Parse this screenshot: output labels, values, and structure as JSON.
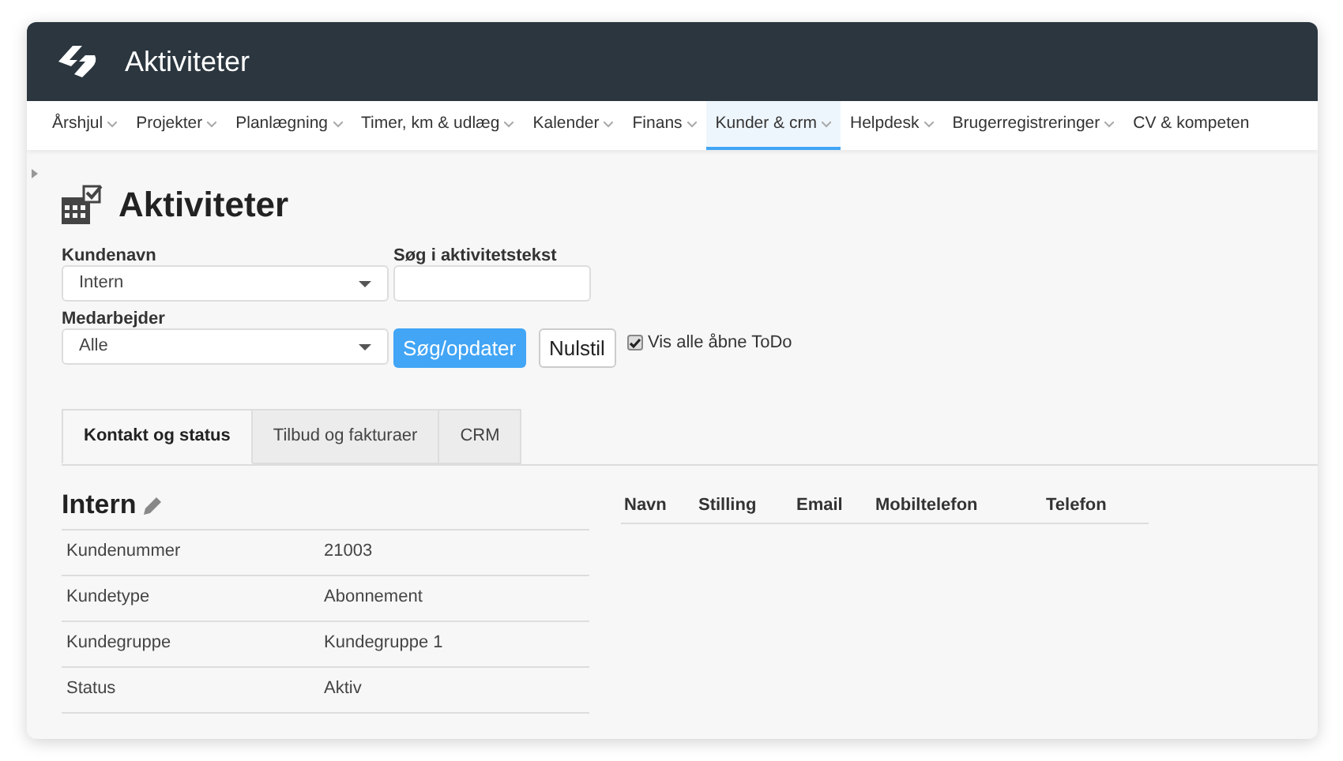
{
  "window": {
    "title": "Aktiviteter"
  },
  "nav": [
    {
      "label": "Årshjul",
      "selected": false
    },
    {
      "label": "Projekter",
      "selected": false
    },
    {
      "label": "Planlægning",
      "selected": false
    },
    {
      "label": "Timer, km & udlæg",
      "selected": false
    },
    {
      "label": "Kalender",
      "selected": false
    },
    {
      "label": "Finans",
      "selected": false
    },
    {
      "label": "Kunder & crm",
      "selected": true
    },
    {
      "label": "Helpdesk",
      "selected": false
    },
    {
      "label": "Brugerregistreringer",
      "selected": false
    },
    {
      "label": "CV & kompeten",
      "selected": false
    }
  ],
  "page_title": "Aktiviteter",
  "filters": {
    "customer": {
      "label": "Kundenavn",
      "value": "Intern"
    },
    "search": {
      "label": "Søg i aktivitetstekst"
    },
    "employee": {
      "label": "Medarbejder",
      "value": "Alle"
    },
    "search_button": "Søg/opdater",
    "reset_button": "Nulstil",
    "show_open_todo": {
      "label": "Vis alle åbne ToDo",
      "checked": true
    }
  },
  "tabs": [
    {
      "label": "Kontakt og status",
      "selected": true
    },
    {
      "label": "Tilbud og fakturaer",
      "selected": false
    },
    {
      "label": "CRM",
      "selected": false
    }
  ],
  "customer": {
    "name": "Intern",
    "fields": [
      {
        "label": "Kundenummer",
        "value": "21003"
      },
      {
        "label": "Kundetype",
        "value": "Abonnement"
      },
      {
        "label": "Kundegruppe",
        "value": "Kundegruppe 1"
      },
      {
        "label": "Status",
        "value": "Aktiv"
      }
    ]
  },
  "contacts": {
    "columns": [
      "Navn",
      "Stilling",
      "Email",
      "Mobiltelefon",
      "Telefon"
    ]
  }
}
